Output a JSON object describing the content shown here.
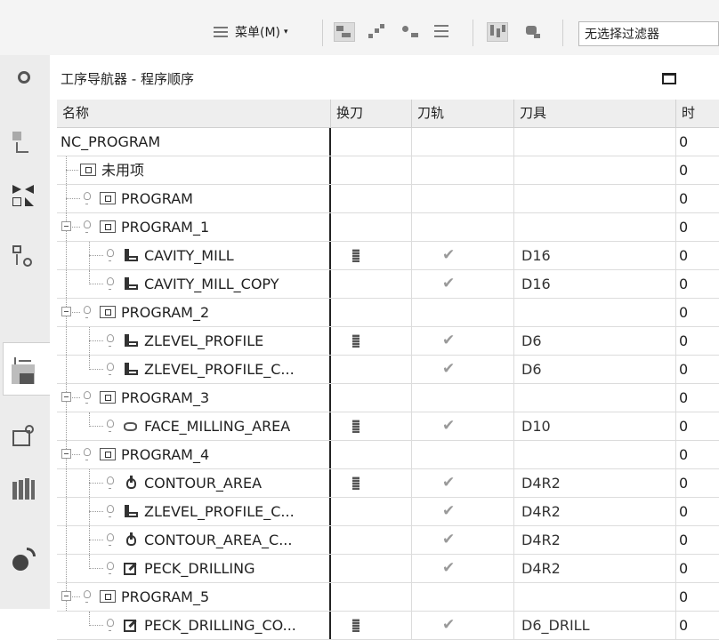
{
  "toolbar": {
    "menu_label": "菜单(M)",
    "menu_caret": "▾",
    "icons": [
      "sort-icon",
      "program-order-icon",
      "machine-view-icon",
      "geometry-view-icon",
      "method-view-icon",
      "tool-view-icon"
    ],
    "filter_value": "无选择过滤器"
  },
  "rail": {
    "icons": [
      "settings-icon",
      "part-navigator-icon",
      "assembly-navigator-icon",
      "constraint-navigator-icon",
      "operation-navigator-icon",
      "machine-tool-navigator-icon",
      "reuse-library-icon",
      "history-icon",
      "roles-icon"
    ]
  },
  "panel": {
    "title": "工序导航器 - 程序顺序",
    "columns": {
      "name": "名称",
      "tool_change": "换刀",
      "path": "刀轨",
      "tool": "刀具",
      "time": "时"
    }
  },
  "rows": [
    {
      "name": "NC_PROGRAM",
      "kind": "root",
      "tool": "",
      "time": "0"
    },
    {
      "name": "未用项",
      "kind": "group",
      "tool": "",
      "time": "0"
    },
    {
      "name": "PROGRAM",
      "kind": "group",
      "tool": "",
      "time": "0"
    },
    {
      "name": "PROGRAM_1",
      "kind": "group",
      "tool": "",
      "time": "0"
    },
    {
      "name": "CAVITY_MILL",
      "kind": "mill",
      "tool_change": true,
      "path": "✔",
      "tool": "D16",
      "time": "0"
    },
    {
      "name": "CAVITY_MILL_COPY",
      "kind": "mill",
      "tool_change": false,
      "path": "✔",
      "tool": "D16",
      "time": "0"
    },
    {
      "name": "PROGRAM_2",
      "kind": "group",
      "tool": "",
      "time": "0"
    },
    {
      "name": "ZLEVEL_PROFILE",
      "kind": "mill",
      "tool_change": true,
      "path": "✔",
      "tool": "D6",
      "time": "0"
    },
    {
      "name": "ZLEVEL_PROFILE_C...",
      "kind": "mill",
      "tool_change": false,
      "path": "✔",
      "tool": "D6",
      "time": "0"
    },
    {
      "name": "PROGRAM_3",
      "kind": "group",
      "tool": "",
      "time": "0"
    },
    {
      "name": "FACE_MILLING_AREA",
      "kind": "face",
      "tool_change": true,
      "path": "✔",
      "tool": "D10",
      "time": "0"
    },
    {
      "name": "PROGRAM_4",
      "kind": "group",
      "tool": "",
      "time": "0"
    },
    {
      "name": "CONTOUR_AREA",
      "kind": "contour",
      "tool_change": true,
      "path": "✔",
      "tool": "D4R2",
      "time": "0"
    },
    {
      "name": "ZLEVEL_PROFILE_C...",
      "kind": "mill",
      "tool_change": false,
      "path": "✔",
      "tool": "D4R2",
      "time": "0"
    },
    {
      "name": "CONTOUR_AREA_C...",
      "kind": "contour",
      "tool_change": false,
      "path": "✔",
      "tool": "D4R2",
      "time": "0"
    },
    {
      "name": "PECK_DRILLING",
      "kind": "drill",
      "tool_change": false,
      "path": "✔",
      "tool": "D4R2",
      "time": "0"
    },
    {
      "name": "PROGRAM_5",
      "kind": "group",
      "tool": "",
      "time": "0"
    },
    {
      "name": "PECK_DRILLING_CO...",
      "kind": "drill",
      "tool_change": true,
      "path": "✔",
      "tool": "D6_DRILL",
      "time": "0"
    }
  ]
}
